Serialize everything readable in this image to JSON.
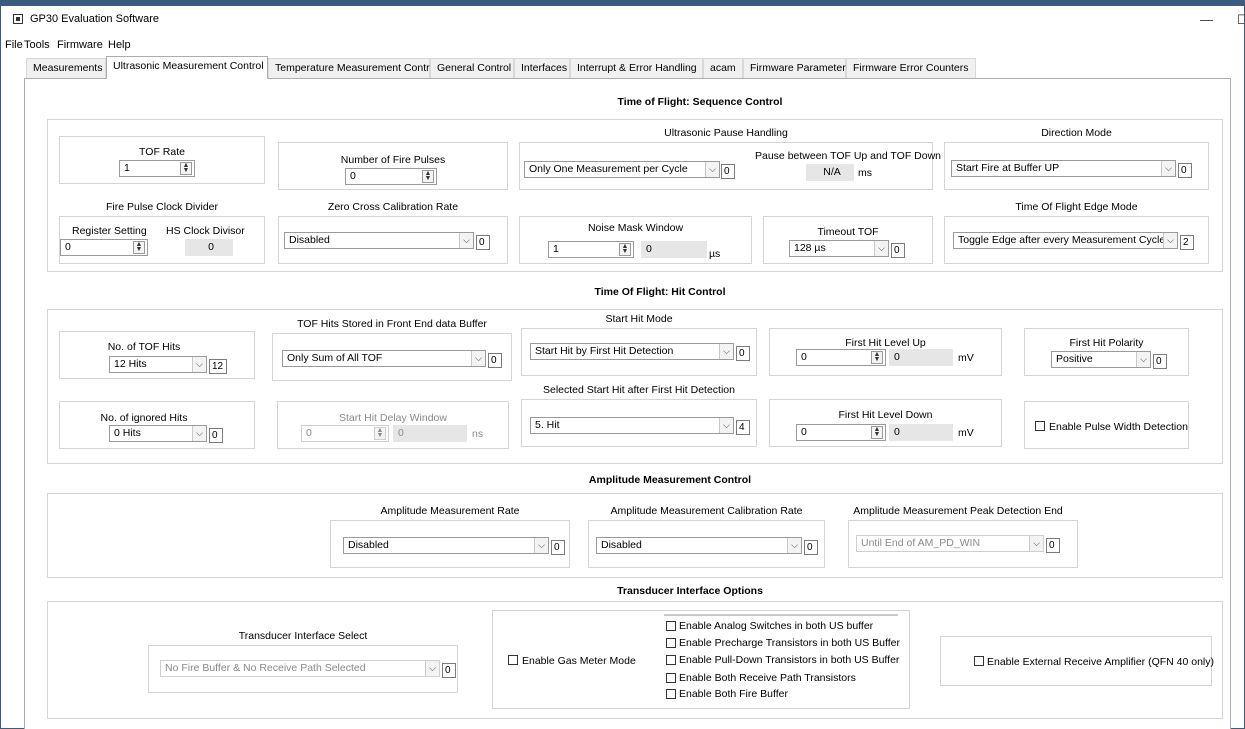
{
  "window": {
    "title": "GP30 Evaluation Software",
    "minimize": "—",
    "maximize": "☐"
  },
  "menu": [
    "File",
    "Tools",
    "Firmware",
    "Help"
  ],
  "tabs": [
    "Measurements",
    "Ultrasonic Measurement Control",
    "Temperature Measurement Control",
    "General Control",
    "Interfaces",
    "Interrupt & Error Handling",
    "acam",
    "Firmware Parameters",
    "Firmware Error Counters"
  ],
  "active_tab": "Ultrasonic Measurement Control",
  "sequence": {
    "title": "Time of Flight: Sequence Control",
    "tof_rate": {
      "label": "TOF Rate",
      "value": "1"
    },
    "fire_pulses": {
      "label": "Number of Fire Pulses",
      "value": "0"
    },
    "pause": {
      "label": "Ultrasonic Pause Handling",
      "select": "Only One Measurement per Cycle",
      "code": "0",
      "between_label": "Pause between TOF Up and TOF Down",
      "between_value": "N/A",
      "between_unit": "ms"
    },
    "direction": {
      "label": "Direction Mode",
      "select": "Start Fire at Buffer UP",
      "code": "0"
    },
    "clock_divider": {
      "label": "Fire Pulse Clock Divider",
      "reg_label": "Register Setting",
      "reg_value": "0",
      "hs_label": "HS Clock Divisor",
      "hs_value": "0"
    },
    "zero_cross": {
      "label": "Zero Cross Calibration Rate",
      "select": "Disabled",
      "code": "0"
    },
    "noise_mask": {
      "label": "Noise Mask Window",
      "value": "1",
      "readout": "0",
      "unit": "µs"
    },
    "timeout": {
      "label": "Timeout TOF",
      "select": "128 µs",
      "code": "0"
    },
    "edge_mode": {
      "label": "Time Of Flight Edge Mode",
      "select": "Toggle Edge after every Measurement Cycle",
      "code": "2"
    }
  },
  "hit": {
    "title": "Time Of Flight: Hit Control",
    "tof_hits": {
      "label": "No. of TOF Hits",
      "select": "12 Hits",
      "code": "12"
    },
    "stored": {
      "label": "TOF Hits Stored in Front End data Buffer",
      "select": "Only Sum of All TOF",
      "code": "0"
    },
    "start_mode": {
      "label": "Start Hit Mode",
      "select": "Start Hit by First Hit Detection",
      "code": "0"
    },
    "level_up": {
      "label": "First Hit Level Up",
      "value": "0",
      "readout": "0",
      "unit": "mV"
    },
    "polarity": {
      "label": "First Hit Polarity",
      "select": "Positive",
      "code": "0"
    },
    "ignored": {
      "label": "No. of ignored Hits",
      "select": "0 Hits",
      "code": "0"
    },
    "delay": {
      "label": "Start Hit Delay Window",
      "value": "0",
      "readout": "0",
      "unit": "ns"
    },
    "selected": {
      "label": "Selected Start Hit after First Hit Detection",
      "select": "5. Hit",
      "code": "4"
    },
    "level_down": {
      "label": "First Hit Level Down",
      "value": "0",
      "readout": "0",
      "unit": "mV"
    },
    "pulse_width": "Enable Pulse Width Detection"
  },
  "amplitude": {
    "title": "Amplitude Measurement Control",
    "rate": {
      "label": "Amplitude Measurement Rate",
      "select": "Disabled",
      "code": "0"
    },
    "cal_rate": {
      "label": "Amplitude Measurement Calibration Rate",
      "select": "Disabled",
      "code": "0"
    },
    "peak_end": {
      "label": "Amplitude Measurement Peak Detection End",
      "select": "Until End of AM_PD_WIN",
      "code": "0"
    }
  },
  "transducer": {
    "title": "Transducer Interface Options",
    "select_label": "Transducer Interface Select",
    "select": "No Fire Buffer & No Receive Path Selected",
    "code": "0",
    "gas_meter": "Enable Gas Meter Mode",
    "options": [
      "Enable Analog Switches in both US buffer",
      "Enable Precharge Transistors in both US Buffer",
      "Enable Pull-Down Transistors in both US Buffer",
      "Enable Both Receive Path Transistors",
      "Enable Both Fire Buffer"
    ],
    "ext_amp": "Enable External Receive Amplifier (QFN 40 only)"
  }
}
